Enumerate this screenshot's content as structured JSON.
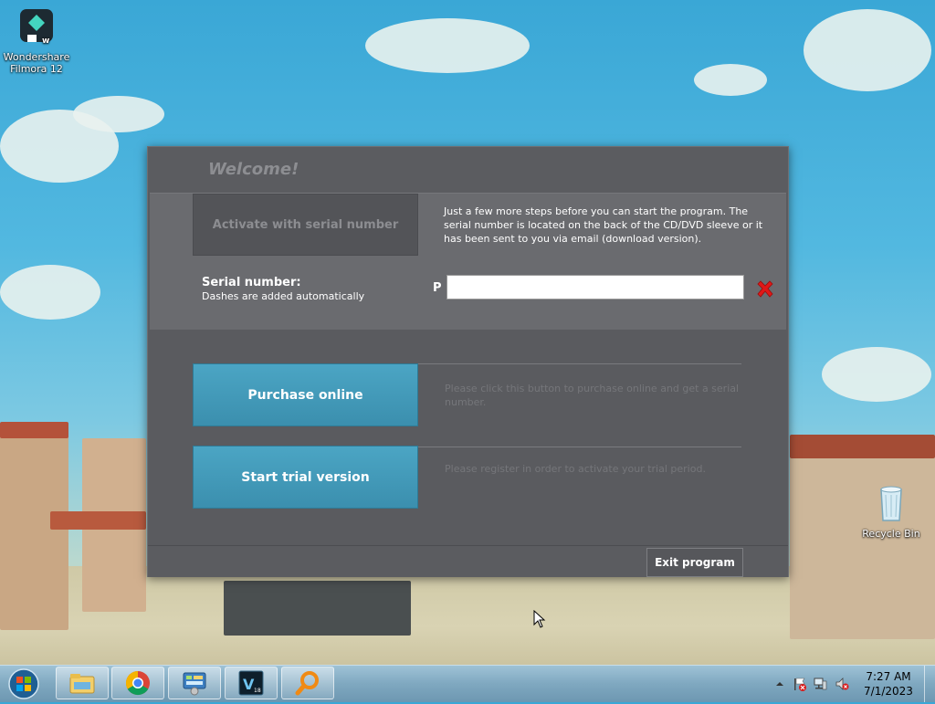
{
  "desktop": {
    "icons": [
      {
        "label_line1": "Wondershare",
        "label_line2": "Filmora 12",
        "icon": "filmora-icon"
      },
      {
        "label": "Recycle Bin",
        "icon": "recycle-bin-icon"
      }
    ]
  },
  "dialog": {
    "title": "Welcome!",
    "activate_label": "Activate with serial number",
    "info_text": "Just a few more steps before you can start the program. The serial number is located on the back of the CD/DVD sleeve or it has been sent to you via email (download version).",
    "serial_label": "Serial number:",
    "serial_sublabel": "Dashes are added automatically",
    "serial_prefix": "P",
    "serial_value": "",
    "clear_icon": "red-x-icon",
    "purchase_label": "Purchase online",
    "purchase_text": "Please click this button to purchase online and get a serial number.",
    "trial_label": "Start trial version",
    "trial_text": "Please register in order to activate your trial period.",
    "exit_label": "Exit program"
  },
  "taskbar": {
    "items": [
      "start-orb",
      "file-explorer-icon",
      "chrome-icon",
      "control-panel-icon",
      "vegas-icon",
      "search-app-icon"
    ],
    "tray_icons": [
      "show-hidden-icons-arrow",
      "action-center-flag-icon",
      "network-icon",
      "volume-muted-icon"
    ],
    "time": "7:27 AM",
    "date": "7/1/2023"
  },
  "colors": {
    "dialog_bg": "#5a5b5f",
    "panel_bg": "#6a6b6f",
    "accent_blue": "#3f98b8",
    "title_text": "#8d8e92"
  }
}
